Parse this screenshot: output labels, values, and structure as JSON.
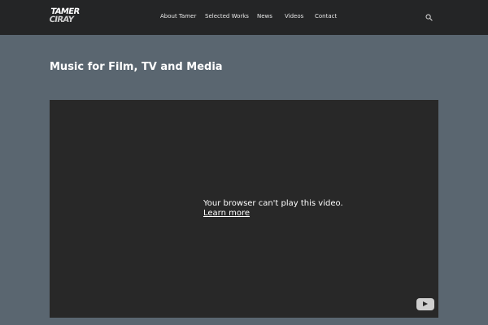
{
  "header": {
    "logo_line1": "TAMER",
    "logo_line2": "CIRAY",
    "nav": [
      {
        "label": "About Tamer"
      },
      {
        "label": "Selected Works"
      },
      {
        "label": "News"
      },
      {
        "label": "Videos"
      },
      {
        "label": "Contact"
      }
    ],
    "search_icon": "search-icon"
  },
  "main": {
    "title": "Music for Film, TV and Media",
    "video": {
      "message": "Your browser can't play this video.",
      "link_label": "Learn more",
      "play_icon": "youtube-play-icon"
    }
  },
  "colors": {
    "header_bg": "#242526",
    "page_bg": "#5a6670",
    "video_bg": "#282828"
  }
}
